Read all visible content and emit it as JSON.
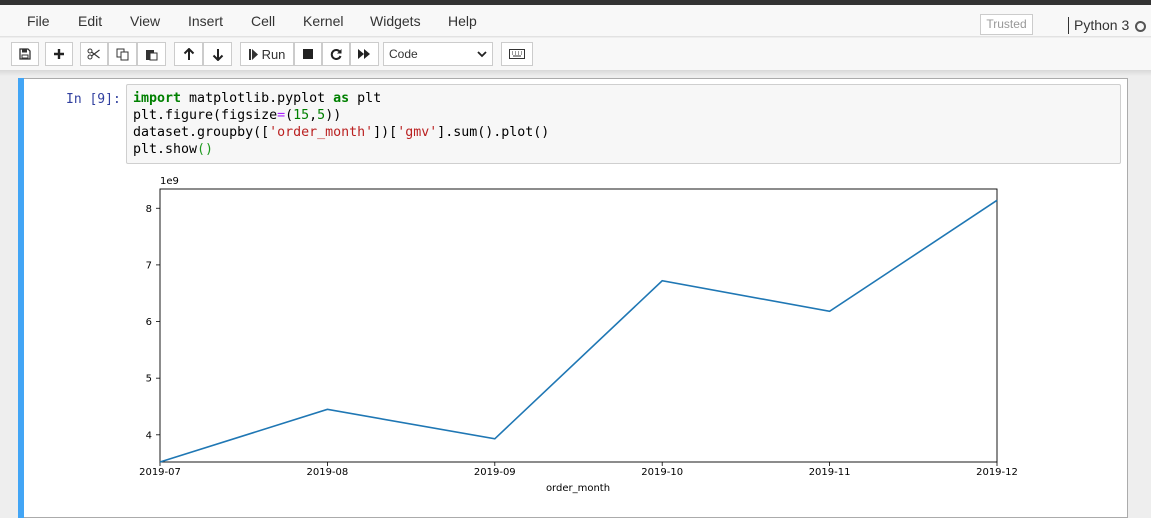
{
  "menu": {
    "items": [
      "File",
      "Edit",
      "View",
      "Insert",
      "Cell",
      "Kernel",
      "Widgets",
      "Help"
    ],
    "trusted": "Trusted",
    "kernel": "Python 3"
  },
  "toolbar": {
    "buttons": [
      "save-icon",
      "plus-icon",
      "scissors-icon",
      "copy-icon",
      "paste-icon",
      "arrow-up-icon",
      "arrow-down-icon",
      "run",
      "stop-icon",
      "restart-icon",
      "fast-forward-icon",
      "keyboard-icon"
    ],
    "run_label": "Run",
    "cell_type": "Code"
  },
  "cell": {
    "prompt": "In [9]:",
    "code": [
      "import matplotlib.pyplot as plt",
      "plt.figure(figsize=(15,5))",
      "dataset.groupby(['order_month'])['gmv'].sum().plot()",
      "plt.show()"
    ]
  },
  "colors": {
    "accent": "#42a5f5",
    "line": "#1f77b4"
  },
  "chart_data": {
    "type": "line",
    "x": [
      "2019-07",
      "2019-08",
      "2019-09",
      "2019-10",
      "2019-11",
      "2019-12"
    ],
    "y": [
      3.52,
      4.45,
      3.93,
      6.72,
      6.18,
      8.14
    ],
    "scale_label": "1e9",
    "xlabel": "order_month",
    "ylabel": "",
    "yticks": [
      4,
      5,
      6,
      7,
      8
    ],
    "ylim": [
      3.52,
      8.34
    ],
    "grid": false
  }
}
